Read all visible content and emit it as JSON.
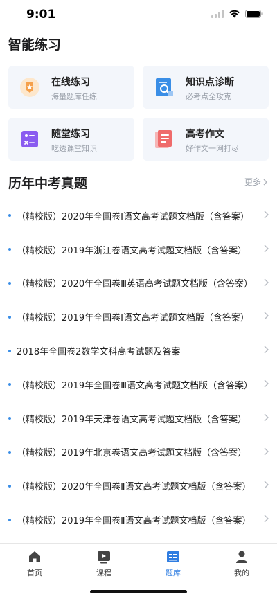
{
  "status_bar": {
    "time": "9:01"
  },
  "smart_practice": {
    "title": "智能练习",
    "cards": [
      {
        "title": "在线练习",
        "subtitle": "海量题库任练",
        "icon": "star-badge-icon",
        "color": "#f5a04b"
      },
      {
        "title": "知识点诊断",
        "subtitle": "必考点全攻克",
        "icon": "search-document-icon",
        "color": "#3a8ee6"
      },
      {
        "title": "随堂练习",
        "subtitle": "吃透课堂知识",
        "icon": "quiz-sheet-icon",
        "color": "#8a5cf0"
      },
      {
        "title": "高考作文",
        "subtitle": "好作文一网打尽",
        "icon": "essay-icon",
        "color": "#ef6b6b"
      }
    ]
  },
  "history_exams": {
    "title": "历年中考真题",
    "more_label": "更多",
    "items": [
      "（精校版）2020年全国卷Ⅰ语文高考试题文档版（含答案）",
      "（精校版）2019年浙江卷语文高考试题文档版（含答案）",
      "（精校版）2020年全国卷Ⅲ英语高考试题文档版（含答案）",
      "（精校版）2019年全国卷Ⅰ语文高考试题文档版（含答案）",
      "2018年全国卷2数学文科高考试题及答案",
      "（精校版）2019年全国卷Ⅲ语文高考试题文档版（含答案）",
      "（精校版）2019年天津卷语文高考试题文档版（含答案）",
      "（精校版）2019年北京卷语文高考试题文档版（含答案）",
      "（精校版）2020年全国卷Ⅱ语文高考试题文档版（含答案）",
      "（精校版）2019年全国卷Ⅱ语文高考试题文档版（含答案）"
    ]
  },
  "tab_bar": {
    "tabs": [
      {
        "label": "首页",
        "icon": "home-icon"
      },
      {
        "label": "课程",
        "icon": "video-icon"
      },
      {
        "label": "题库",
        "icon": "question-bank-icon",
        "active": true
      },
      {
        "label": "我的",
        "icon": "user-icon"
      }
    ],
    "active_color": "#2f7de1"
  }
}
